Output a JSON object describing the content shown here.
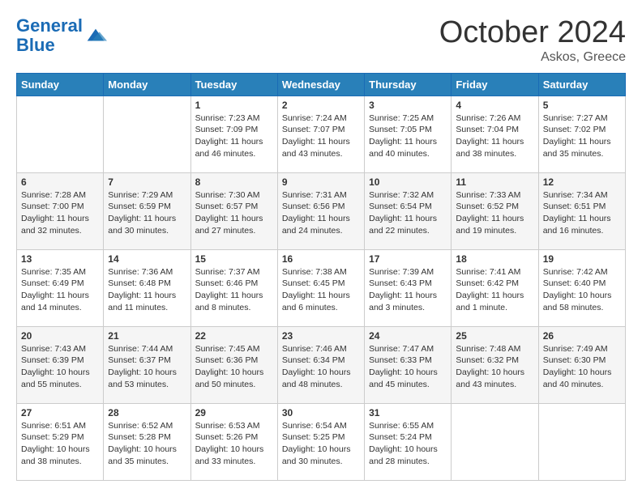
{
  "header": {
    "logo_line1": "General",
    "logo_line2": "Blue",
    "month": "October 2024",
    "location": "Askos, Greece"
  },
  "days_of_week": [
    "Sunday",
    "Monday",
    "Tuesday",
    "Wednesday",
    "Thursday",
    "Friday",
    "Saturday"
  ],
  "weeks": [
    [
      {
        "day": "",
        "info": ""
      },
      {
        "day": "",
        "info": ""
      },
      {
        "day": "1",
        "info": "Sunrise: 7:23 AM\nSunset: 7:09 PM\nDaylight: 11 hours and 46 minutes."
      },
      {
        "day": "2",
        "info": "Sunrise: 7:24 AM\nSunset: 7:07 PM\nDaylight: 11 hours and 43 minutes."
      },
      {
        "day": "3",
        "info": "Sunrise: 7:25 AM\nSunset: 7:05 PM\nDaylight: 11 hours and 40 minutes."
      },
      {
        "day": "4",
        "info": "Sunrise: 7:26 AM\nSunset: 7:04 PM\nDaylight: 11 hours and 38 minutes."
      },
      {
        "day": "5",
        "info": "Sunrise: 7:27 AM\nSunset: 7:02 PM\nDaylight: 11 hours and 35 minutes."
      }
    ],
    [
      {
        "day": "6",
        "info": "Sunrise: 7:28 AM\nSunset: 7:00 PM\nDaylight: 11 hours and 32 minutes."
      },
      {
        "day": "7",
        "info": "Sunrise: 7:29 AM\nSunset: 6:59 PM\nDaylight: 11 hours and 30 minutes."
      },
      {
        "day": "8",
        "info": "Sunrise: 7:30 AM\nSunset: 6:57 PM\nDaylight: 11 hours and 27 minutes."
      },
      {
        "day": "9",
        "info": "Sunrise: 7:31 AM\nSunset: 6:56 PM\nDaylight: 11 hours and 24 minutes."
      },
      {
        "day": "10",
        "info": "Sunrise: 7:32 AM\nSunset: 6:54 PM\nDaylight: 11 hours and 22 minutes."
      },
      {
        "day": "11",
        "info": "Sunrise: 7:33 AM\nSunset: 6:52 PM\nDaylight: 11 hours and 19 minutes."
      },
      {
        "day": "12",
        "info": "Sunrise: 7:34 AM\nSunset: 6:51 PM\nDaylight: 11 hours and 16 minutes."
      }
    ],
    [
      {
        "day": "13",
        "info": "Sunrise: 7:35 AM\nSunset: 6:49 PM\nDaylight: 11 hours and 14 minutes."
      },
      {
        "day": "14",
        "info": "Sunrise: 7:36 AM\nSunset: 6:48 PM\nDaylight: 11 hours and 11 minutes."
      },
      {
        "day": "15",
        "info": "Sunrise: 7:37 AM\nSunset: 6:46 PM\nDaylight: 11 hours and 8 minutes."
      },
      {
        "day": "16",
        "info": "Sunrise: 7:38 AM\nSunset: 6:45 PM\nDaylight: 11 hours and 6 minutes."
      },
      {
        "day": "17",
        "info": "Sunrise: 7:39 AM\nSunset: 6:43 PM\nDaylight: 11 hours and 3 minutes."
      },
      {
        "day": "18",
        "info": "Sunrise: 7:41 AM\nSunset: 6:42 PM\nDaylight: 11 hours and 1 minute."
      },
      {
        "day": "19",
        "info": "Sunrise: 7:42 AM\nSunset: 6:40 PM\nDaylight: 10 hours and 58 minutes."
      }
    ],
    [
      {
        "day": "20",
        "info": "Sunrise: 7:43 AM\nSunset: 6:39 PM\nDaylight: 10 hours and 55 minutes."
      },
      {
        "day": "21",
        "info": "Sunrise: 7:44 AM\nSunset: 6:37 PM\nDaylight: 10 hours and 53 minutes."
      },
      {
        "day": "22",
        "info": "Sunrise: 7:45 AM\nSunset: 6:36 PM\nDaylight: 10 hours and 50 minutes."
      },
      {
        "day": "23",
        "info": "Sunrise: 7:46 AM\nSunset: 6:34 PM\nDaylight: 10 hours and 48 minutes."
      },
      {
        "day": "24",
        "info": "Sunrise: 7:47 AM\nSunset: 6:33 PM\nDaylight: 10 hours and 45 minutes."
      },
      {
        "day": "25",
        "info": "Sunrise: 7:48 AM\nSunset: 6:32 PM\nDaylight: 10 hours and 43 minutes."
      },
      {
        "day": "26",
        "info": "Sunrise: 7:49 AM\nSunset: 6:30 PM\nDaylight: 10 hours and 40 minutes."
      }
    ],
    [
      {
        "day": "27",
        "info": "Sunrise: 6:51 AM\nSunset: 5:29 PM\nDaylight: 10 hours and 38 minutes."
      },
      {
        "day": "28",
        "info": "Sunrise: 6:52 AM\nSunset: 5:28 PM\nDaylight: 10 hours and 35 minutes."
      },
      {
        "day": "29",
        "info": "Sunrise: 6:53 AM\nSunset: 5:26 PM\nDaylight: 10 hours and 33 minutes."
      },
      {
        "day": "30",
        "info": "Sunrise: 6:54 AM\nSunset: 5:25 PM\nDaylight: 10 hours and 30 minutes."
      },
      {
        "day": "31",
        "info": "Sunrise: 6:55 AM\nSunset: 5:24 PM\nDaylight: 10 hours and 28 minutes."
      },
      {
        "day": "",
        "info": ""
      },
      {
        "day": "",
        "info": ""
      }
    ]
  ]
}
